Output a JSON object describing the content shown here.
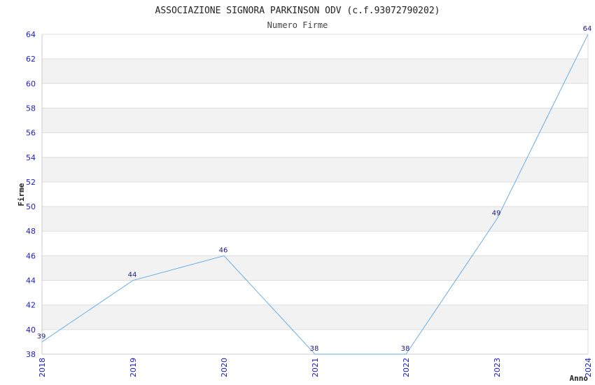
{
  "chart_data": {
    "type": "line",
    "title": "ASSOCIAZIONE SIGNORA PARKINSON ODV (c.f.93072790202)",
    "subtitle": "Numero Firme",
    "xlabel": "Anno",
    "ylabel": "Firme",
    "x": [
      "2018",
      "2019",
      "2020",
      "2021",
      "2022",
      "2023",
      "2024"
    ],
    "series": [
      {
        "values": [
          39,
          44,
          46,
          38,
          38,
          49,
          64
        ]
      }
    ],
    "ylim": [
      38,
      64
    ],
    "yticks": [
      "38",
      "40",
      "42",
      "44",
      "46",
      "48",
      "50",
      "52",
      "54",
      "56",
      "58",
      "60",
      "62",
      "64"
    ],
    "grid": true,
    "colors": {
      "line": "#6aaee8",
      "tick_text": "#1a1acc",
      "point_label": "#1a1a80",
      "band": "#f2f2f2",
      "grid": "#dddddd"
    }
  }
}
